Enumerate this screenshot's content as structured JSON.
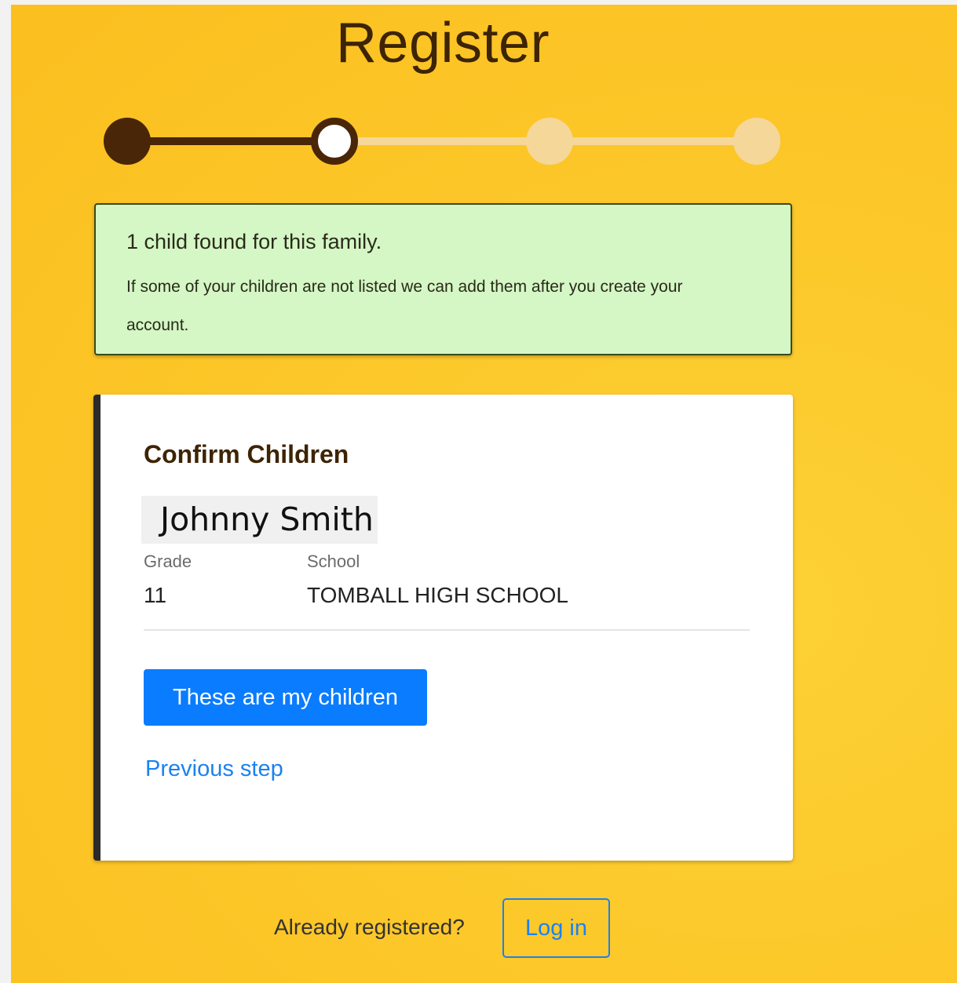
{
  "page": {
    "title": "Register"
  },
  "stepper": {
    "steps_total": 4,
    "current_step": 2,
    "colors": {
      "done": "#4a2608",
      "todo": "#f5d79a"
    }
  },
  "alert": {
    "headline": "1 child found for this family.",
    "message": "If some of your children are not listed we can add them after you create your account.",
    "background_color": "#d4f7c5"
  },
  "card": {
    "title": "Confirm Children",
    "children": [
      {
        "name": "Johnny Smith",
        "grade_label": "Grade",
        "grade": "11",
        "school_label": "School",
        "school": "TOMBALL HIGH SCHOOL"
      }
    ],
    "confirm_label": "These are my children",
    "previous_label": "Previous step"
  },
  "footer": {
    "prompt": "Already registered?",
    "login_label": "Log in"
  },
  "colors": {
    "background": "#fcc82a",
    "primary": "#0a7cff",
    "link": "#1a82f0",
    "title_text": "#3d2405"
  }
}
